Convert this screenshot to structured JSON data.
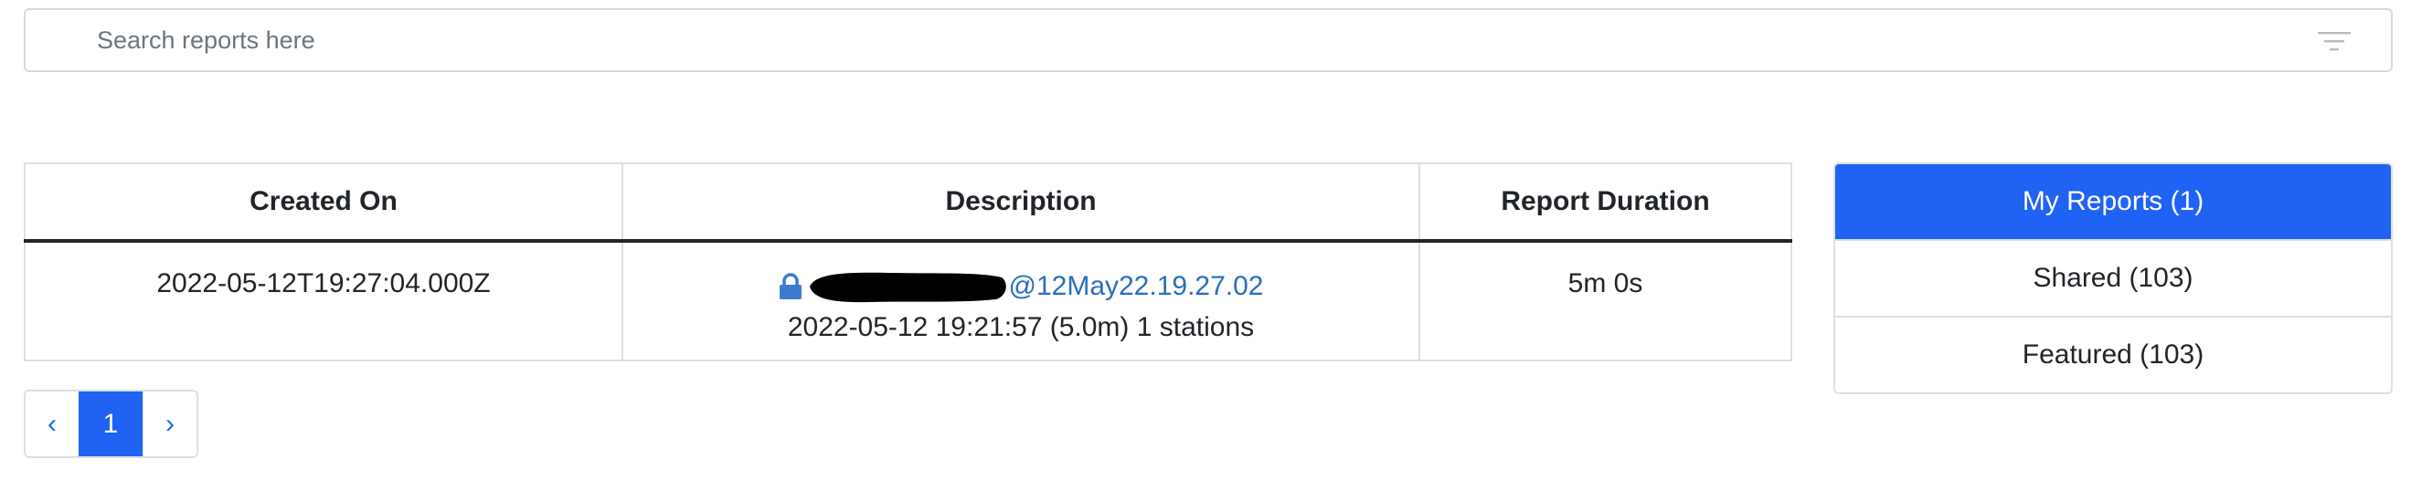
{
  "search": {
    "placeholder": "Search reports here"
  },
  "table": {
    "headers": [
      "Created On",
      "Description",
      "Report Duration"
    ],
    "rows": [
      {
        "created_on": "2022-05-12T19:27:04.000Z",
        "description_link_suffix": "@12May22.19.27.02",
        "description_detail": "2022-05-12 19:21:57 (5.0m) 1 stations",
        "duration": "5m 0s"
      }
    ]
  },
  "pagination": {
    "prev": "‹",
    "current": "1",
    "next": "›"
  },
  "report_filters": [
    {
      "label": "My Reports (1)",
      "active": true
    },
    {
      "label": "Shared (103)",
      "active": false
    },
    {
      "label": "Featured (103)",
      "active": false
    }
  ],
  "colors": {
    "accent": "#1f62f4",
    "link": "#2a6ebb",
    "border": "#dcdfe2"
  },
  "icons": [
    "filter-icon",
    "lock-icon"
  ]
}
